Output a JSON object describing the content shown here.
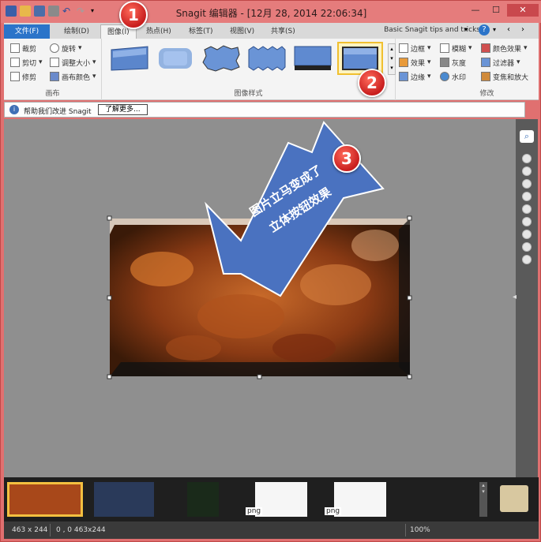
{
  "window": {
    "title": "Snagit 编辑器 - [12月 28, 2014 22:06:34]",
    "help_tips": "Basic Snagit tips and tricks"
  },
  "tabs": [
    {
      "label": "文件(F)"
    },
    {
      "label": "绘制(D)"
    },
    {
      "label": "图像(I)"
    },
    {
      "label": "热点(H)"
    },
    {
      "label": "标签(T)"
    },
    {
      "label": "视图(V)"
    },
    {
      "label": "共享(S)"
    }
  ],
  "ribbon": {
    "canvas_group": {
      "label": "画布",
      "buttons": [
        "裁剪",
        "旋转",
        "剪切",
        "调整大小",
        "修剪",
        "画布颜色"
      ]
    },
    "styles_group": {
      "label": "图像样式"
    },
    "edge_buttons": [
      "边框",
      "效果",
      "边缘"
    ],
    "modify_group": {
      "label": "修改",
      "buttons": [
        "模糊",
        "颜色效果",
        "灰度",
        "过滤器",
        "水印",
        "变焦和放大"
      ]
    }
  },
  "infobar": {
    "message": "帮助我们改进 Snagit",
    "learn_more": "了解更多..."
  },
  "annotations": {
    "badge_1": "1",
    "badge_2": "2",
    "badge_3": "3",
    "arrow_text_line1": "图片立马变成了",
    "arrow_text_line2": "立体按钮效果"
  },
  "filmstrip": {
    "labels": [
      "png",
      "png"
    ]
  },
  "status": {
    "size": "463 x 244",
    "coords": "0 , 0   463x244",
    "zoom": "100%"
  },
  "colors": {
    "window_frame": "#e07070",
    "file_tab": "#2b74c9",
    "canvas_bg": "#8f8f8f",
    "arrow_fill": "#4a72c0",
    "badge_red": "#d02a2a"
  }
}
